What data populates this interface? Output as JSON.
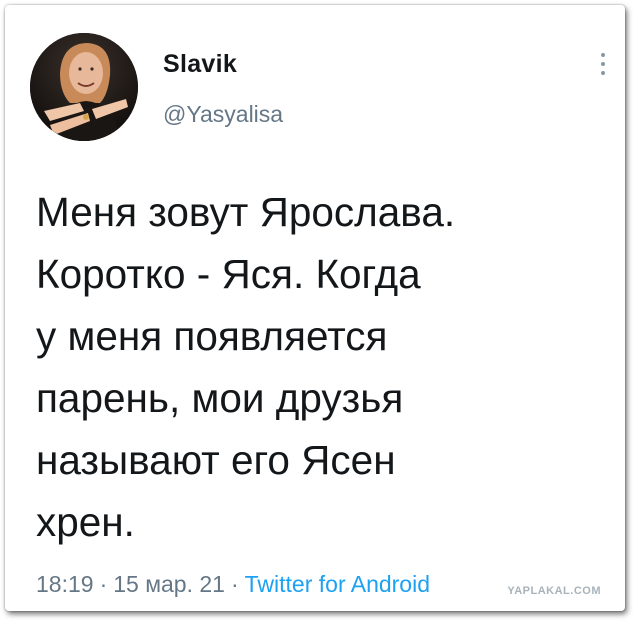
{
  "tweet": {
    "author_name": "Slavik",
    "author_handle": "@Yasyalisa",
    "text": "Меня зовут Ярослава.\nКоротко - Яся. Когда\nу меня появляется\nпарень, мои друзья\nназывают его Ясен\nхрен.",
    "time": "18:19",
    "date": "15 мар. 21",
    "separator": "·",
    "client": "Twitter for Android"
  },
  "icons": {
    "menu": "more-vertical-icon",
    "avatar": "profile-photo"
  },
  "watermark": "YAPLAKAL.COM",
  "colors": {
    "text": "#14171a",
    "secondary": "#657786",
    "link": "#1da1f2",
    "card_background": "#ffffff"
  }
}
